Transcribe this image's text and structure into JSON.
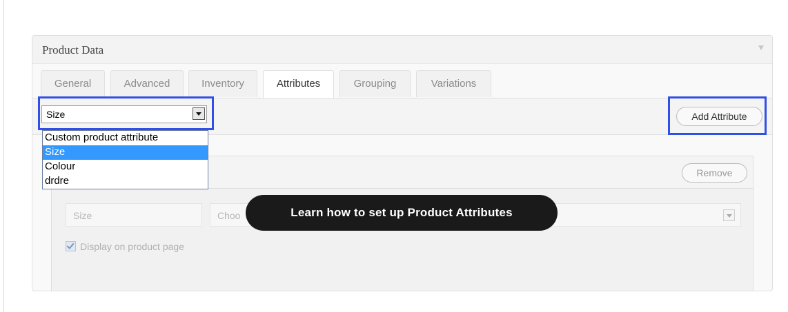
{
  "panel": {
    "title": "Product Data"
  },
  "tabs": [
    {
      "label": "General"
    },
    {
      "label": "Advanced"
    },
    {
      "label": "Inventory"
    },
    {
      "label": "Attributes",
      "active": true
    },
    {
      "label": "Grouping"
    },
    {
      "label": "Variations"
    }
  ],
  "toolbar": {
    "attribute_select_value": "Size",
    "add_attribute_label": "Add Attribute"
  },
  "dropdown": {
    "options": [
      "Custom product attribute",
      "Size",
      "Colour",
      "drdre"
    ],
    "selected": "Size"
  },
  "attribute_row": {
    "remove_label": "Remove",
    "name_value": "Size",
    "values_placeholder": "Choo",
    "display_checkbox_label": "Display on product page",
    "display_checked": true
  },
  "tooltip": {
    "text": "Learn how to set up Product Attributes"
  },
  "colors": {
    "highlight": "#2f4fe8",
    "tooltip_bg": "#1a1a1a",
    "selected_option_bg": "#3399ff"
  },
  "icons": [
    "collapse-arrow-icon",
    "dropdown-arrow-icon",
    "checkbox-checked-icon"
  ]
}
